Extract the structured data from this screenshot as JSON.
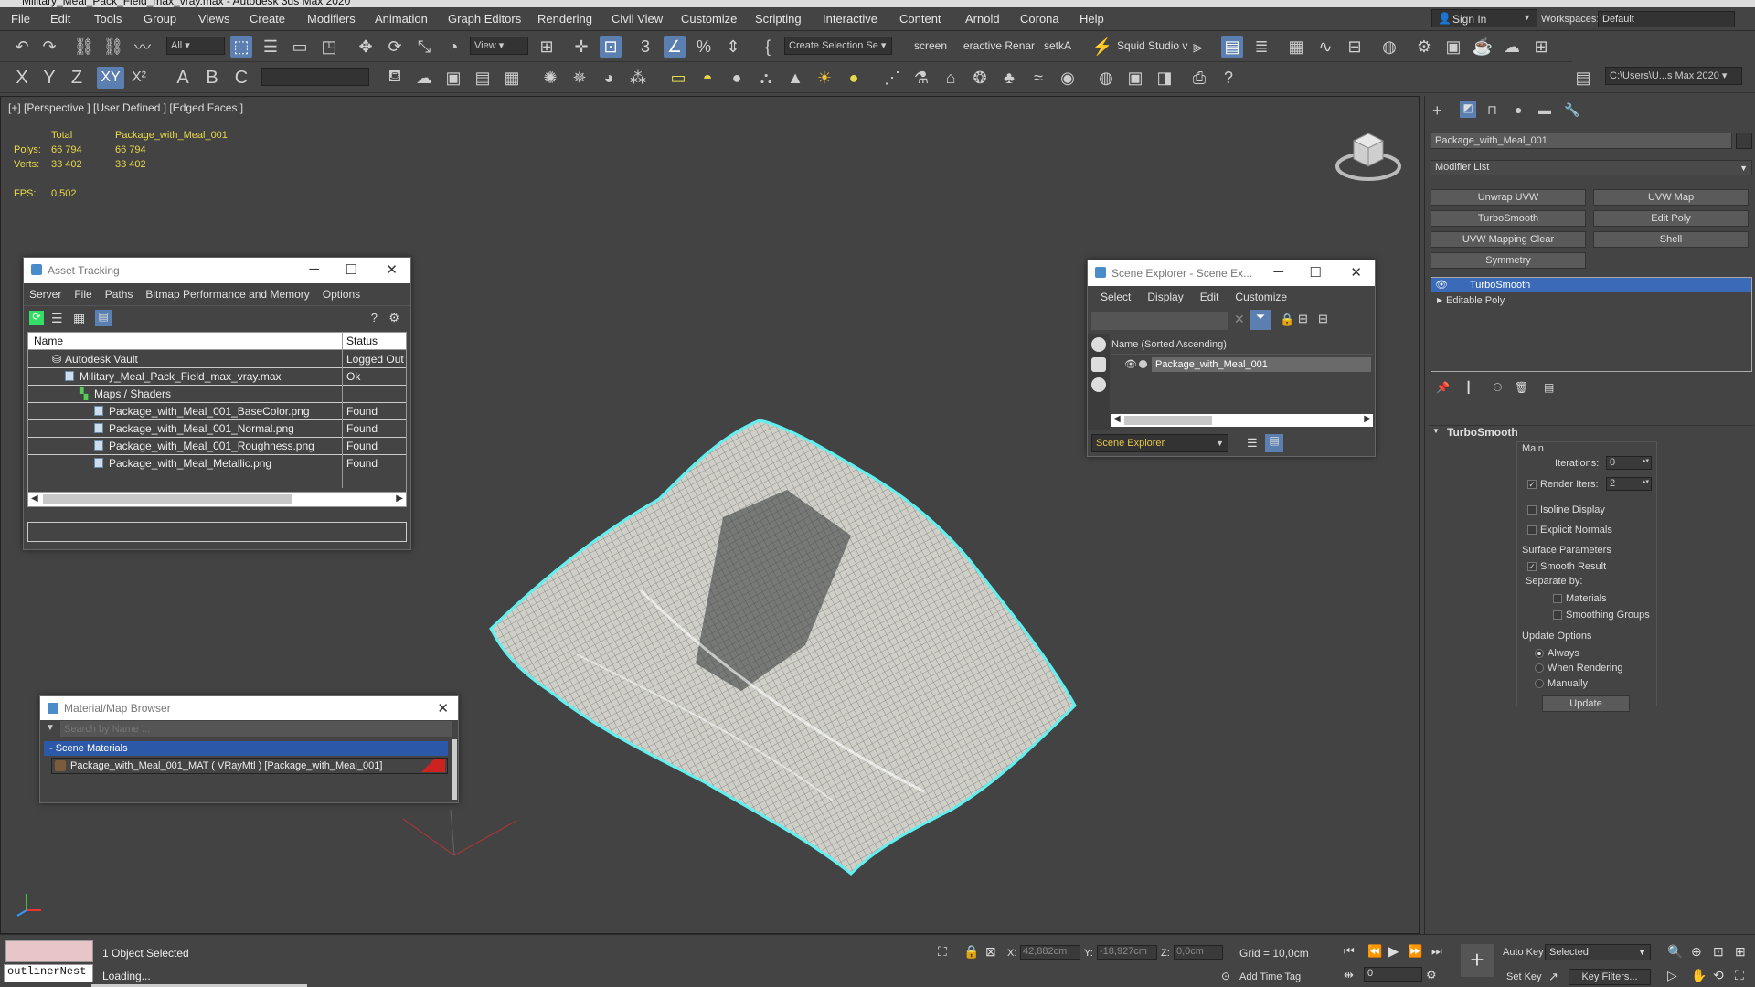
{
  "app": {
    "title": "Military_Meal_Pack_Field_max_vray.max - Autodesk 3ds Max 2020"
  },
  "menus": [
    "File",
    "Edit",
    "Tools",
    "Group",
    "Views",
    "Create",
    "Modifiers",
    "Animation",
    "Graph Editors",
    "Rendering",
    "Civil View",
    "Customize",
    "Scripting",
    "Interactive",
    "Content",
    "Arnold",
    "Corona",
    "Help"
  ],
  "account": {
    "sign_in": "Sign In",
    "workspaces_label": "Workspaces:",
    "workspace": "Default"
  },
  "toolbar1": {
    "filter": "All",
    "view": "View",
    "selection_set": "Create Selection Se",
    "screen": "screen",
    "interactive": "eractive Renar",
    "setka": "setkA",
    "squid": "Squid Studio v"
  },
  "toolbar2": {
    "x": "X",
    "y": "Y",
    "z": "Z",
    "xy": "XY",
    "xp": "X²",
    "path": "C:\\Users\\U...s Max 2020"
  },
  "viewport": {
    "label": "[+] [Perspective ] [User Defined ] [Edged Faces ]",
    "stats": {
      "total_label": "Total",
      "object_label": "Package_with_Meal_001",
      "polys_label": "Polys:",
      "polys_total": "66 794",
      "polys_obj": "66 794",
      "verts_label": "Verts:",
      "verts_total": "33 402",
      "verts_obj": "33 402",
      "fps_label": "FPS:",
      "fps": "0,502"
    }
  },
  "asset_tracking": {
    "title": "Asset Tracking",
    "menu": [
      "Server",
      "File",
      "Paths",
      "Bitmap Performance and Memory",
      "Options"
    ],
    "col_name": "Name",
    "col_status": "Status",
    "rows": [
      {
        "name": "Autodesk Vault",
        "status": "Logged Out"
      },
      {
        "name": "Military_Meal_Pack_Field_max_vray.max",
        "status": "Ok"
      },
      {
        "name": "Maps / Shaders",
        "status": ""
      },
      {
        "name": "Package_with_Meal_001_BaseColor.png",
        "status": "Found"
      },
      {
        "name": "Package_with_Meal_001_Normal.png",
        "status": "Found"
      },
      {
        "name": "Package_with_Meal_001_Roughness.png",
        "status": "Found"
      },
      {
        "name": "Package_with_Meal_Metallic.png",
        "status": "Found"
      }
    ]
  },
  "scene_explorer": {
    "title": "Scene Explorer - Scene Ex...",
    "menu": [
      "Select",
      "Display",
      "Edit",
      "Customize"
    ],
    "col_name": "Name (Sorted Ascending)",
    "item": "Package_with_Meal_001",
    "footer": "Scene Explorer"
  },
  "material_browser": {
    "title": "Material/Map Browser",
    "search_placeholder": "Search by Name ...",
    "section": "- Scene Materials",
    "item": "Package_with_Meal_001_MAT  ( VRayMtl )  [Package_with_Meal_001]"
  },
  "command_panel": {
    "object_name": "Package_with_Meal_001",
    "modifier_list": "Modifier List",
    "buttons": [
      "Unwrap UVW",
      "UVW Map",
      "TurboSmooth",
      "Edit Poly",
      "UVW Mapping Clear",
      "Shell",
      "Symmetry"
    ],
    "stack": [
      "TurboSmooth",
      "Editable Poly"
    ],
    "rollout": {
      "title": "TurboSmooth",
      "main": "Main",
      "iterations_label": "Iterations:",
      "iterations": "0",
      "render_iters_label": "Render Iters:",
      "render_iters": "2",
      "isoline": "Isoline Display",
      "explicit_normals": "Explicit Normals",
      "surface_params": "Surface Parameters",
      "smooth_result": "Smooth Result",
      "separate_by": "Separate by:",
      "materials": "Materials",
      "smoothing_groups": "Smoothing Groups",
      "update_options": "Update Options",
      "always": "Always",
      "when_rendering": "When Rendering",
      "manually": "Manually",
      "update": "Update"
    }
  },
  "status": {
    "maxscript": "outlinerNest",
    "selected": "1 Object Selected",
    "loading": "Loading...",
    "x_label": "X:",
    "x": "42,882cm",
    "y_label": "Y:",
    "y": "-18,927cm",
    "z_label": "Z:",
    "z": "0,0cm",
    "grid": "Grid = 10,0cm",
    "add_time_tag": "Add Time Tag",
    "auto_key": "Auto Key",
    "set_key": "Set Key",
    "selected_dd": "Selected",
    "key_filters": "Key Filters...",
    "frame": "0"
  }
}
